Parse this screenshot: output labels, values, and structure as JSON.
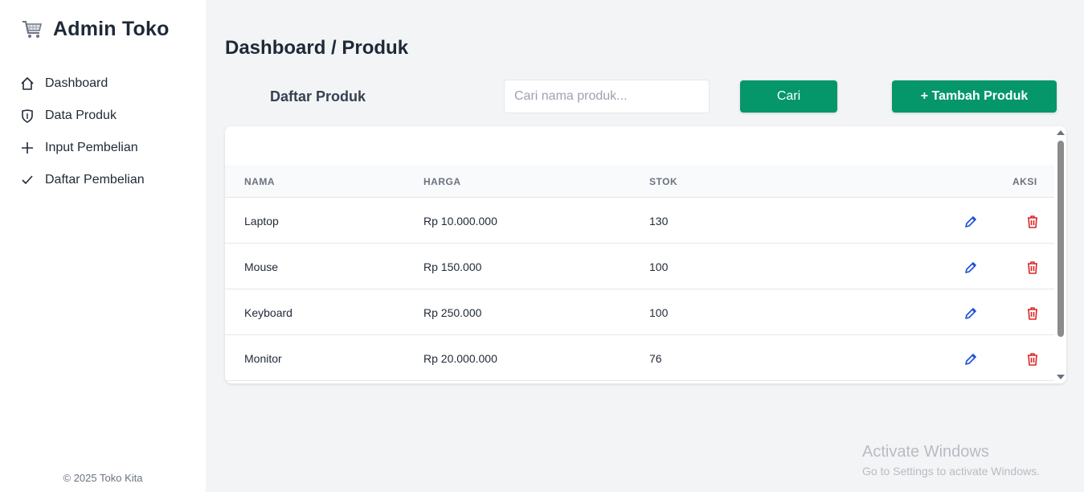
{
  "sidebar": {
    "brand_icon": "shopping-cart-icon",
    "brand_title": "Admin Toko",
    "items": [
      {
        "label": "Dashboard",
        "icon": "home-icon"
      },
      {
        "label": "Data Produk",
        "icon": "shield-icon"
      },
      {
        "label": "Input Pembelian",
        "icon": "plus-icon"
      },
      {
        "label": "Daftar Pembelian",
        "icon": "check-icon"
      }
    ],
    "footer": "© 2025 Toko Kita"
  },
  "main": {
    "page_title": "Dashboard / Produk",
    "section_title": "Daftar Produk",
    "search": {
      "placeholder": "Cari nama produk...",
      "value": ""
    },
    "search_button": "Cari",
    "add_button": "+ Tambah Produk",
    "table": {
      "headers": {
        "nama": "NAMA",
        "harga": "HARGA",
        "stok": "STOK",
        "aksi": "AKSI"
      },
      "rows": [
        {
          "nama": "Laptop",
          "harga": "Rp 10.000.000",
          "stok": "130"
        },
        {
          "nama": "Mouse",
          "harga": "Rp 150.000",
          "stok": "100"
        },
        {
          "nama": "Keyboard",
          "harga": "Rp 250.000",
          "stok": "100"
        },
        {
          "nama": "Monitor",
          "harga": "Rp 20.000.000",
          "stok": "76"
        }
      ]
    }
  },
  "watermark": {
    "title": "Activate Windows",
    "subtitle": "Go to Settings to activate Windows."
  },
  "colors": {
    "primary": "#059669",
    "edit": "#1d4ed8",
    "delete": "#dc2626",
    "background": "#f3f4f6"
  }
}
